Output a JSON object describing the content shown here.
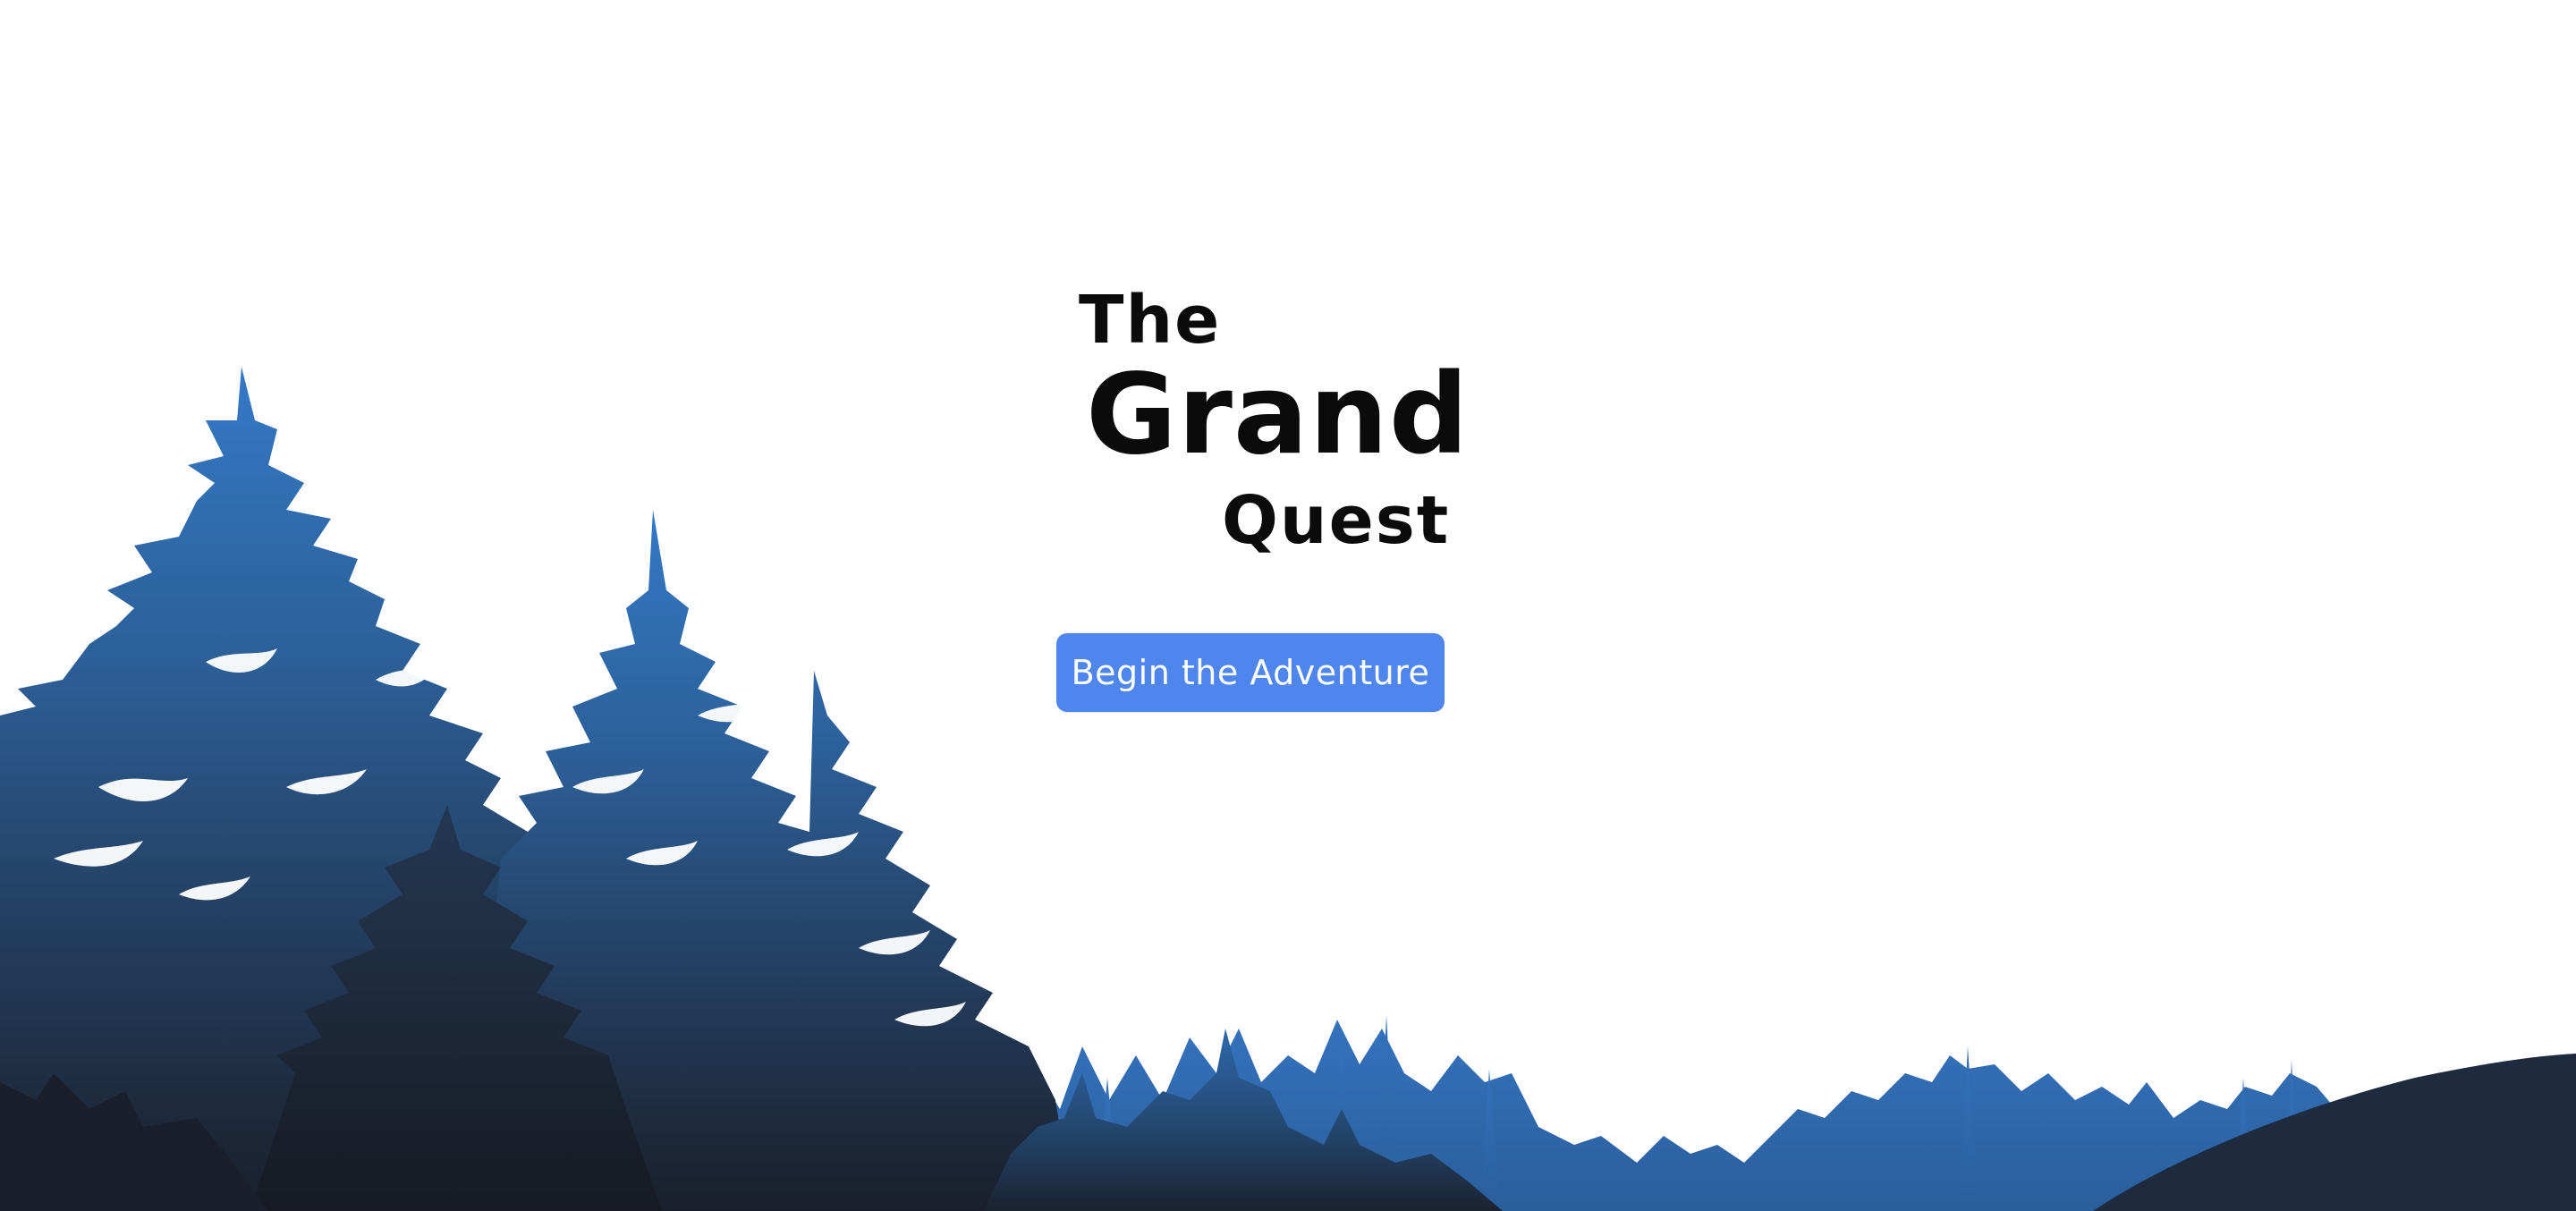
{
  "title": {
    "line1": "The",
    "line2": "Grand",
    "line3": "Quest"
  },
  "cta": {
    "label": "Begin the Adventure"
  },
  "colors": {
    "background": "#ffffff",
    "title_text": "#0b0b0b",
    "button": "#4f86ee",
    "button_text": "#ffffff",
    "tree_light": "#2f6fbf",
    "tree_mid": "#27527f",
    "tree_dark": "#1b2230",
    "hill": "#1e2a3d"
  },
  "decor": {
    "foreground": "forest-silhouette",
    "far_right": "hill-silhouette"
  }
}
